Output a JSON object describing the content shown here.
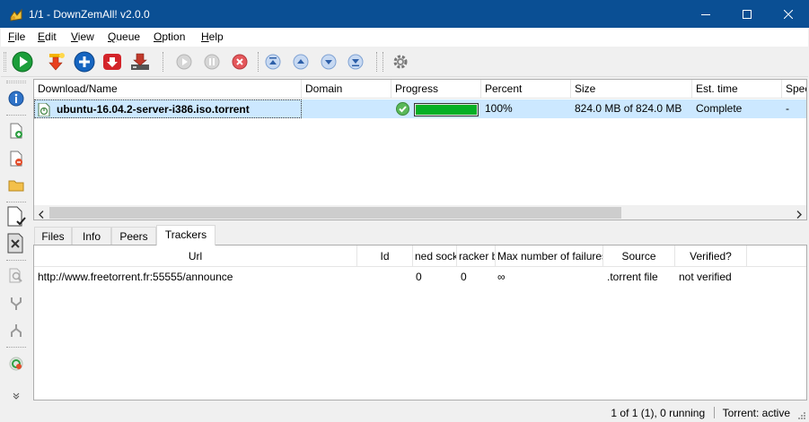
{
  "window": {
    "title": "1/1 - DownZemAll! v2.0.0",
    "controls": {
      "minimize": "minimize",
      "maximize": "maximize",
      "close": "close"
    }
  },
  "menu": [
    {
      "label": "File",
      "mnemonic": "F",
      "rest": "ile"
    },
    {
      "label": "Edit",
      "mnemonic": "E",
      "rest": "dit"
    },
    {
      "label": "View",
      "mnemonic": "V",
      "rest": "iew"
    },
    {
      "label": "Queue",
      "mnemonic": "Q",
      "rest": "ueue"
    },
    {
      "label": "Option",
      "mnemonic": "O",
      "rest": "ption"
    },
    {
      "label": "Help",
      "mnemonic": "H",
      "rest": "elp"
    }
  ],
  "toolbar": {
    "icons": [
      "start-icon",
      "add-downloads-icon",
      "add-new-icon",
      "download-batch-icon",
      "wizard-icon",
      "resume-icon",
      "pause-icon",
      "cancel-icon",
      "move-top-icon",
      "move-up-icon",
      "move-down-icon",
      "move-bottom-icon",
      "settings-icon"
    ]
  },
  "sidebar": {
    "icons": [
      "info-icon",
      "open-file-icon",
      "delete-file-icon",
      "open-folder-icon",
      "check-file-icon",
      "remove-completed-icon",
      "find-icon",
      "merge-icon",
      "split-icon",
      "refresh-icon",
      "more-icon"
    ]
  },
  "downloads": {
    "columns": [
      "Download/Name",
      "Domain",
      "Progress",
      "Percent",
      "Size",
      "Est. time",
      "Speed"
    ],
    "rows": [
      {
        "name": "ubuntu-16.04.2-server-i386.iso.torrent",
        "domain": "",
        "progress": 1.0,
        "percent": "100%",
        "size": "824.0 MB of 824.0 MB",
        "est_time": "Complete",
        "speed": "-"
      }
    ]
  },
  "tabs": [
    {
      "label": "Files",
      "active": false
    },
    {
      "label": "Info",
      "active": false
    },
    {
      "label": "Peers",
      "active": false
    },
    {
      "label": "Trackers",
      "active": true
    }
  ],
  "trackers": {
    "columns": [
      "Url",
      "Id",
      "ned socke",
      "racker b",
      "Max number of failures",
      "Source",
      "Verified?"
    ],
    "rows": [
      {
        "url": "http://www.freetorrent.fr:55555/announce",
        "id": "",
        "sockets": "0",
        "tracker_b": "0",
        "max_failures": "∞",
        "source": ".torrent file",
        "verified": "not verified"
      }
    ]
  },
  "status": {
    "text": "1 of 1 (1), 0 running",
    "torrent": "Torrent: active"
  }
}
